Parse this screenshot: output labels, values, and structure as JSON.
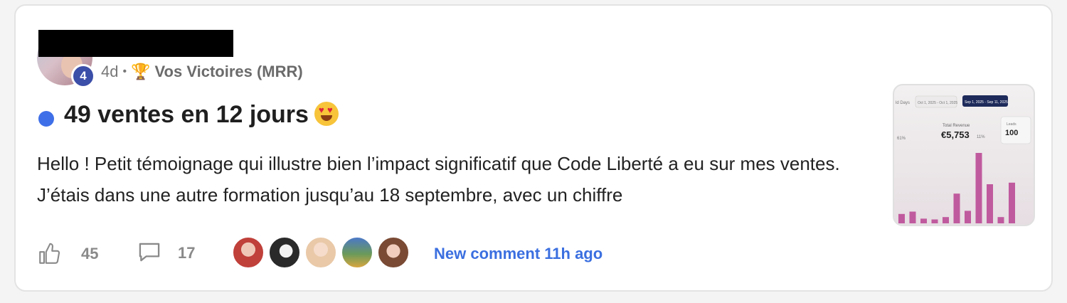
{
  "post": {
    "author_level": "4",
    "time_ago": "4d",
    "separator": "•",
    "category_icon": "trophy-icon",
    "category": "Vos Victoires (MRR)",
    "title": "49 ventes en 12 jours",
    "title_emoji": "heart-eyes-emoji",
    "excerpt": "Hello ! Petit témoignage qui illustre bien l’impact significatif que Code Liberté a eu sur mes ventes. J’étais dans une autre formation jusqu’au 18 septembre, avec un chiffre",
    "unread_color": "#3f6fe8"
  },
  "thumbnail": {
    "tab_left": "Oct 1, 2025 - Oct 1, 2025",
    "tab_active": "Sep 1, 2025 - Sep 11, 2025",
    "edge_label": "ld Days",
    "metric_label": "Total Revenue",
    "metric_value": "€5,753",
    "metric_change": "11%",
    "left_change": "61%",
    "side_label": "Leads",
    "side_value": "100",
    "bar_levels": [
      0.12,
      0.15,
      0.06,
      0.05,
      0.08,
      0.38,
      0.16,
      0.9,
      0.5,
      0.08,
      0.52
    ]
  },
  "footer": {
    "like_icon": "thumbs-up-icon",
    "likes": "45",
    "comment_icon": "comment-icon",
    "comments": "17",
    "new_comment_text": "New comment 11h ago",
    "link_color": "#3b6fe0"
  }
}
